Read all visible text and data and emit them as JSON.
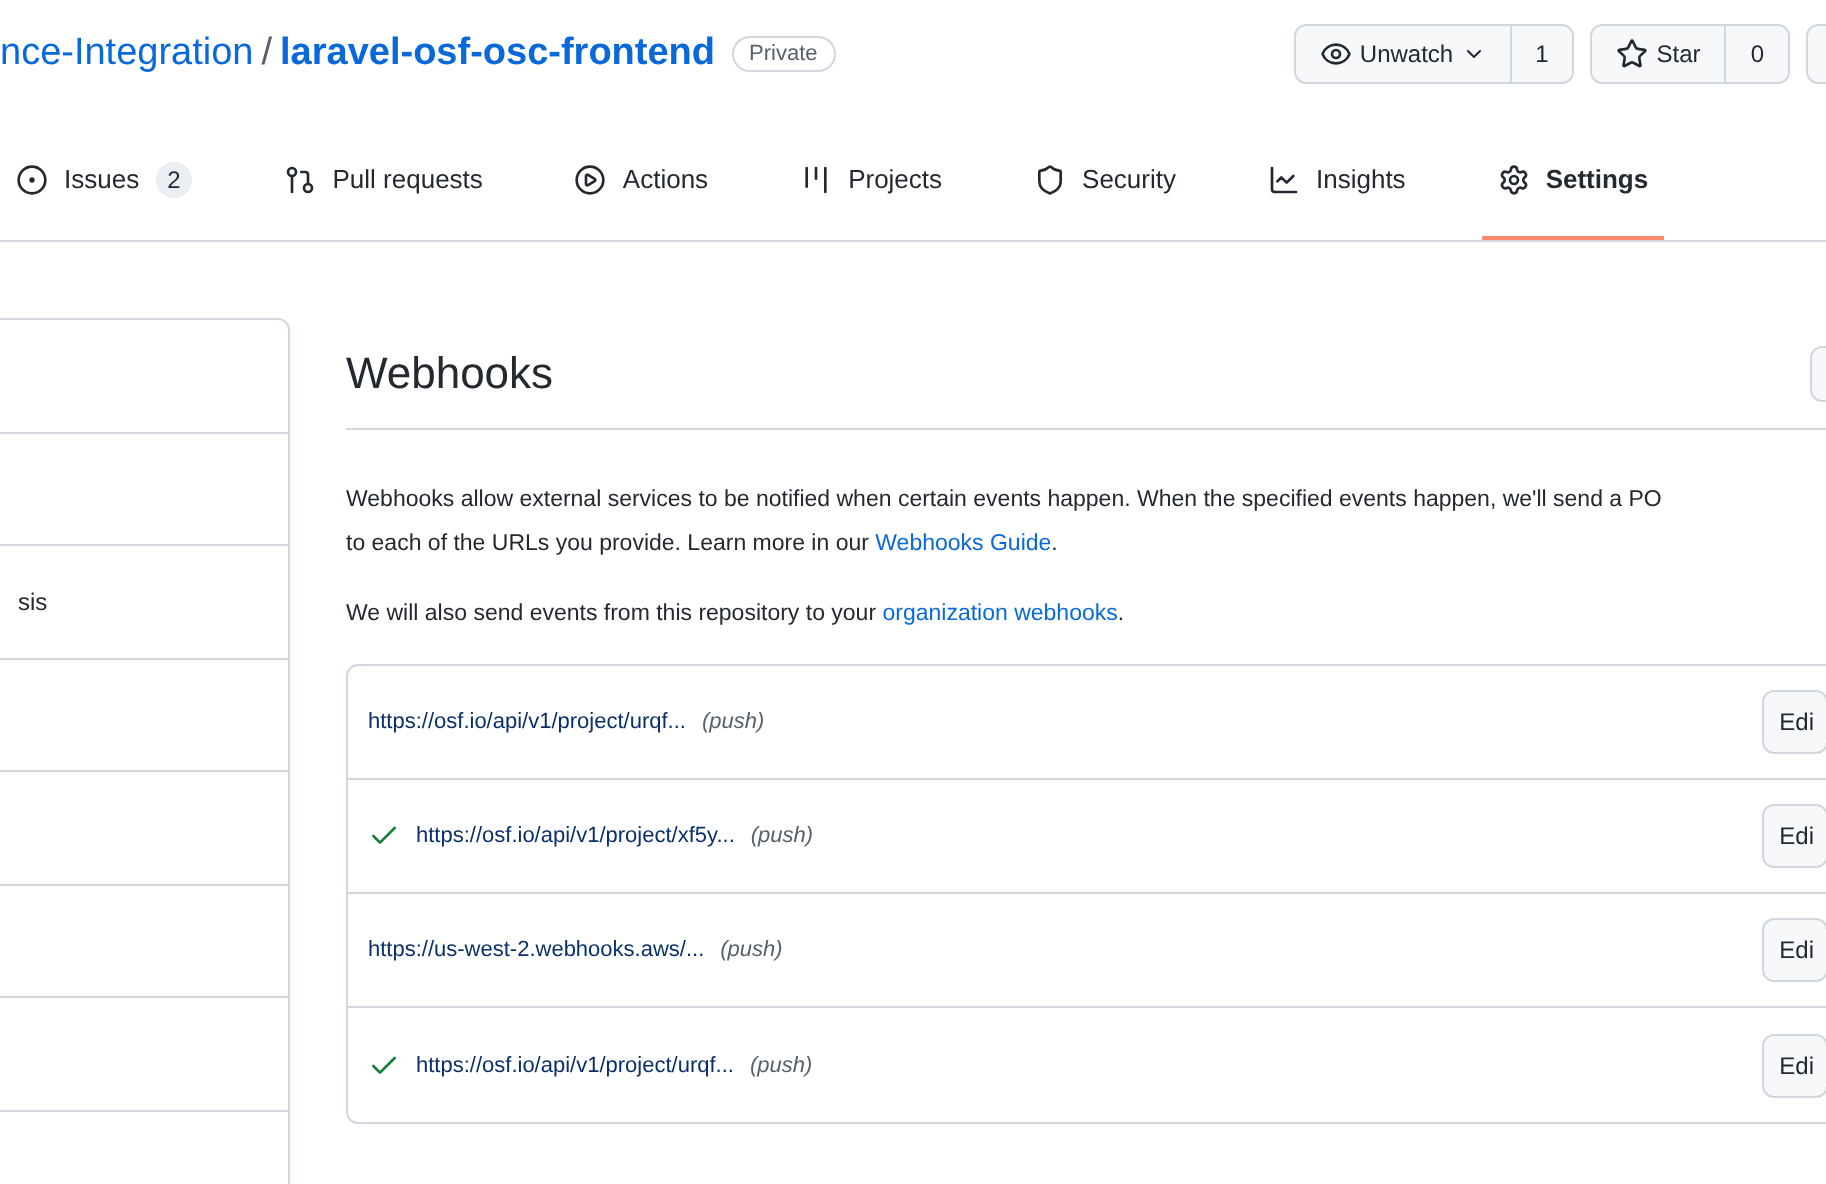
{
  "repo": {
    "owner": "nce-Integration",
    "separator": "/",
    "name": "laravel-osf-osc-frontend",
    "visibility": "Private"
  },
  "actions": [
    {
      "kind": "watch",
      "label": "Unwatch",
      "count": "1"
    },
    {
      "kind": "star",
      "label": "Star",
      "count": "0"
    }
  ],
  "tabs": [
    {
      "kind": "issues",
      "label": "Issues",
      "count": "2",
      "selected": false
    },
    {
      "kind": "pulls",
      "label": "Pull requests",
      "selected": false
    },
    {
      "kind": "actions",
      "label": "Actions",
      "selected": false
    },
    {
      "kind": "projects",
      "label": "Projects",
      "selected": false
    },
    {
      "kind": "security",
      "label": "Security",
      "selected": false
    },
    {
      "kind": "insights",
      "label": "Insights",
      "selected": false
    },
    {
      "kind": "settings",
      "label": "Settings",
      "selected": true
    }
  ],
  "sidebar": {
    "items": [
      {
        "label": "sis"
      }
    ]
  },
  "webhooks": {
    "title": "Webhooks",
    "intro": "Webhooks allow external services to be notified when certain events happen. When the specified events happen, we'll send a PO",
    "intro_line2": "to each of the URLs you provide. Learn more in our ",
    "guide_link": "Webhooks Guide",
    "intro_end": ".",
    "org_text": "We will also send events from this repository to your ",
    "org_link": "organization webhooks",
    "org_end": ".",
    "hooks": [
      {
        "url": "https://osf.io/api/v1/project/urqf...",
        "events": "(push)",
        "delivered": false,
        "button": "Edi"
      },
      {
        "url": "https://osf.io/api/v1/project/xf5y...",
        "events": "(push)",
        "delivered": true,
        "button": "Edi"
      },
      {
        "url": "https://us-west-2.webhooks.aws/...",
        "events": "(push)",
        "delivered": false,
        "button": "Edi"
      },
      {
        "url": "https://osf.io/api/v1/project/urqf...",
        "events": "(push)",
        "delivered": true,
        "button": "Edi"
      }
    ]
  }
}
